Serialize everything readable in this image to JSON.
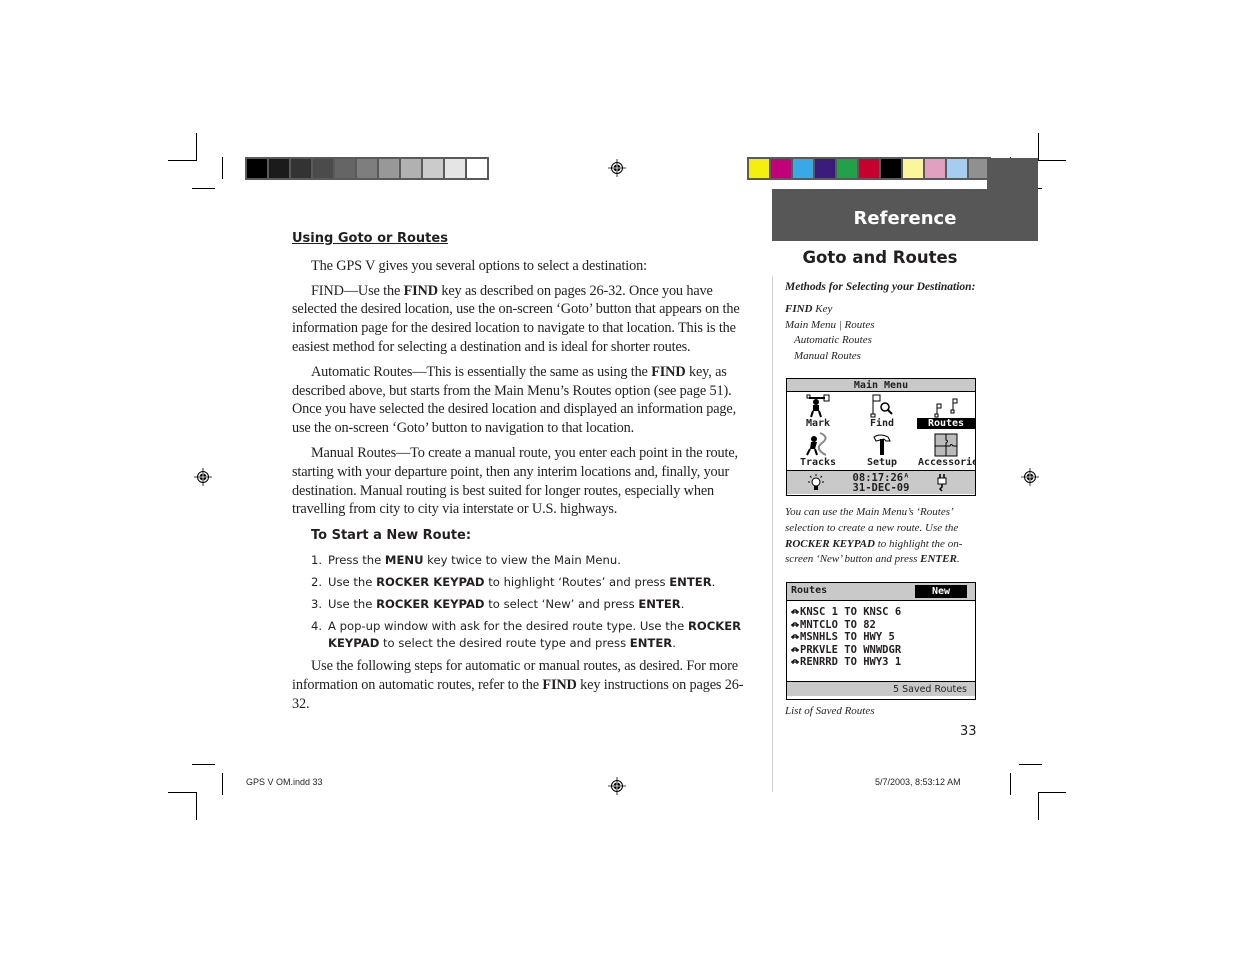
{
  "print_marks": {
    "grayscale_swatches": [
      "#000000",
      "#1b1b1b",
      "#333333",
      "#4b4b4b",
      "#656565",
      "#7e7e7e",
      "#989898",
      "#b1b1b1",
      "#cbcbcb",
      "#e5e5e5",
      "#ffffff"
    ],
    "color_swatches": [
      "#f5ef0e",
      "#c1007a",
      "#37a9e6",
      "#3b1b7b",
      "#22a04a",
      "#c8002d",
      "#000000",
      "#fbf69c",
      "#e1a0bf",
      "#a4cdf1",
      "#909090"
    ],
    "slug_left": "GPS V OM.indd   33",
    "slug_right": "5/7/2003, 8:53:12 AM"
  },
  "header": {
    "section": "Reference",
    "accent_color": "#575757"
  },
  "main": {
    "heading": "Using Goto or Routes",
    "intro": "The GPS V gives you several options to select a destination:",
    "find_para": {
      "lead": "FIND—Use the ",
      "key": "FIND",
      "rest": " key as described on pages 26-32.  Once you have selected the desired location, use the on-screen ‘Goto’ button that appears on the information page for the desired location to navigate to that location.  This is the easiest method for selecting a destination and is ideal for shorter routes."
    },
    "auto_para": {
      "lead": "Automatic Routes—This is essentially the same as using the ",
      "key": "FIND",
      "rest": " key, as described above, but starts from the Main Menu’s Routes option (see page 51).  Once you have selected the desired location and displayed an information page, use the on-screen ‘Goto’ button to navigation to that location."
    },
    "manual_para": "Manual Routes—To create a manual route, you enter each point in the route, starting with your departure point, then any interim locations and, finally, your destination. Manual routing is best suited for longer routes, especially when travelling from city to city via interstate or U.S. highways.",
    "start_heading": "To Start a New Route:",
    "steps": [
      {
        "num": "1.",
        "parts": [
          {
            "t": "Press the "
          },
          {
            "b": "MENU"
          },
          {
            "t": " key twice to view the Main Menu."
          }
        ]
      },
      {
        "num": "2.",
        "parts": [
          {
            "t": "Use the "
          },
          {
            "b": "ROCKER KEYPAD"
          },
          {
            "t": " to highlight ‘Routes’ and press "
          },
          {
            "b": "ENTER"
          },
          {
            "t": "."
          }
        ]
      },
      {
        "num": "3.",
        "parts": [
          {
            "t": "Use the "
          },
          {
            "b": "ROCKER KEYPAD"
          },
          {
            "t": " to select ‘New’ and press "
          },
          {
            "b": "ENTER"
          },
          {
            "t": "."
          }
        ]
      },
      {
        "num": "4.",
        "parts": [
          {
            "t": "A pop-up window with ask for the desired route type. Use the "
          },
          {
            "b": "ROCKER KEYPAD"
          },
          {
            "t": " to select the desired route type and press "
          },
          {
            "b": "ENTER"
          },
          {
            "t": "."
          }
        ]
      }
    ],
    "closing_para": {
      "lead": "Use the following steps for automatic or manual routes, as desired.  For more information on automatic routes, refer to the ",
      "key": "FIND",
      "rest": " key instructions on pages 26-32."
    }
  },
  "sidebar": {
    "title": "Goto and Routes",
    "subtitle": "Methods for Selecting your Destination:",
    "find_key": "FIND",
    "find_key_suffix": " Key",
    "menu_path": "Main Menu | Routes",
    "route_types": [
      "Automatic Routes",
      "Manual Routes"
    ],
    "main_menu_screen": {
      "title": "Main Menu",
      "items": [
        {
          "label": "Mark",
          "icon": "mark-icon",
          "selected": false
        },
        {
          "label": "Find",
          "icon": "find-icon",
          "selected": false
        },
        {
          "label": "Routes",
          "icon": "routes-icon",
          "selected": true
        },
        {
          "label": "Tracks",
          "icon": "tracks-icon",
          "selected": false
        },
        {
          "label": "Setup",
          "icon": "setup-icon",
          "selected": false
        },
        {
          "label": "Accessories",
          "icon": "accessories-icon",
          "selected": false
        }
      ],
      "time": "08:17:26ᴬ",
      "date": "31-DEC-09"
    },
    "caption1": {
      "p1": "You can use the Main Menu’s ‘Routes’ selection to create a new route. Use the ",
      "k1": "ROCKER KEYPAD",
      "p2": " to highlight the on-screen ‘New’ button and press ",
      "k2": "ENTER",
      "p3": "."
    },
    "routes_screen": {
      "title": "Routes",
      "new_button": "New",
      "routes": [
        "KNSC 1 TO KNSC 6",
        "MNTCLO TO 82",
        "MSNHLS TO HWY 5",
        "PRKVLE TO WNWDGR",
        "RENRRD TO HWY3 1"
      ],
      "footer": "5 Saved Routes"
    },
    "caption2": "List of Saved Routes"
  },
  "page_number": "33"
}
